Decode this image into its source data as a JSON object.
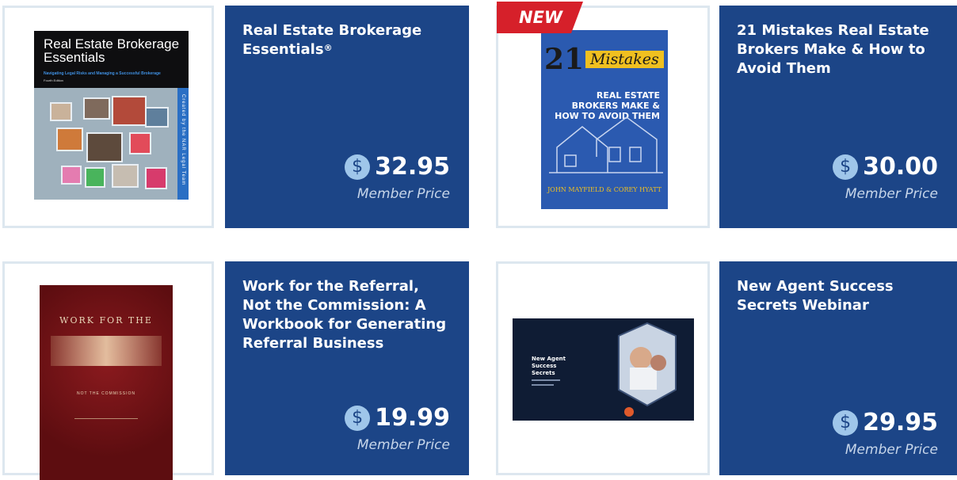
{
  "currency_icon": "dollar-circle-icon",
  "colors": {
    "panel": "#1c4587",
    "coin": "#9fc6ea",
    "border": "#dde7ef",
    "new_tag": "#d6202a"
  },
  "products": [
    {
      "title": "Real Estate Brokerage Essentials",
      "title_mark": "®",
      "price": "32.95",
      "price_label": "Member Price",
      "cover": {
        "title": "Real Estate Brokerage Essentials",
        "subtitle": "Navigating Legal Risks and Managing a Successful Brokerage",
        "edition": "Fourth Edition",
        "side": "Created by the NAR Legal Team"
      }
    },
    {
      "title": "21 Mistakes Real Estate Brokers Make & How to Avoid Them",
      "badge": "NEW",
      "price": "30.00",
      "price_label": "Member Price",
      "cover": {
        "number": "21",
        "word": "Mistakes",
        "lines": "REAL ESTATE BROKERS MAKE & HOW TO AVOID THEM",
        "authors": "JOHN MAYFIELD & COREY HYATT"
      }
    },
    {
      "title": "Work for the Referral, Not the Commission: A Workbook for Generating Referral Business",
      "price": "19.99",
      "price_label": "Member Price",
      "cover": {
        "top": "WORK FOR THE",
        "sub": "NOT THE COMMISSION"
      }
    },
    {
      "title": "New Agent Success Secrets Webinar",
      "price": "29.95",
      "price_label": "Member Price",
      "cover": {
        "title": "New Agent Success Secrets"
      }
    }
  ]
}
